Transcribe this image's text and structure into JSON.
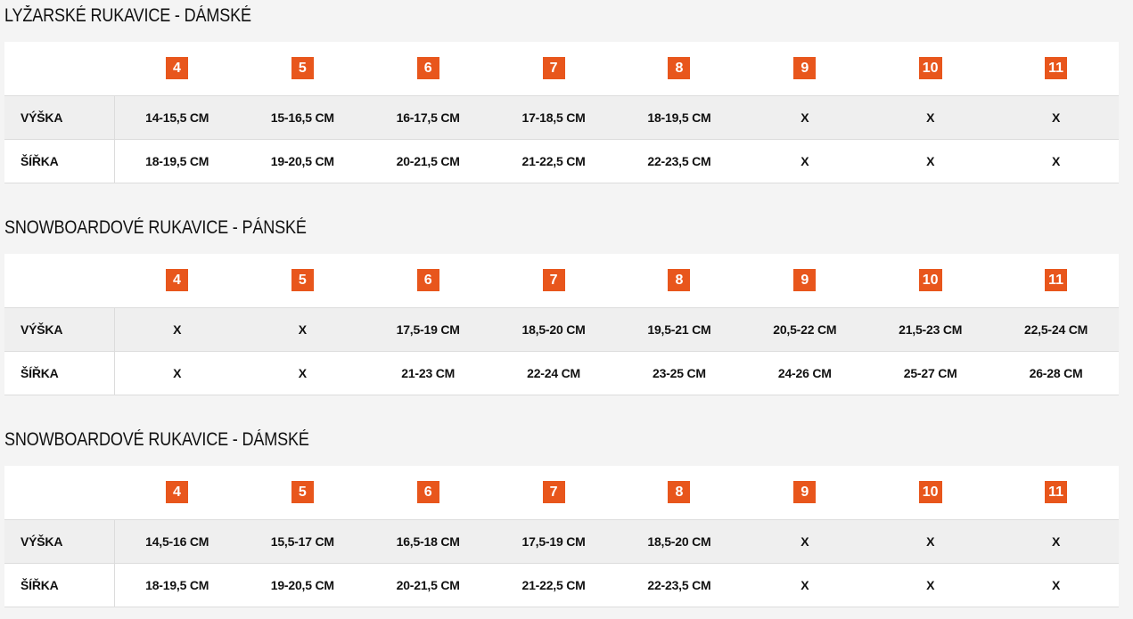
{
  "sizes": [
    "4",
    "5",
    "6",
    "7",
    "8",
    "9",
    "10",
    "11"
  ],
  "tables": [
    {
      "title": "LYŽARSKÉ RUKAVICE - DÁMSKÉ",
      "rows": [
        {
          "label": "VÝŠKA",
          "values": [
            "14-15,5 CM",
            "15-16,5 CM",
            "16-17,5 CM",
            "17-18,5 CM",
            "18-19,5 CM",
            "X",
            "X",
            "X"
          ]
        },
        {
          "label": "ŠÍŘKA",
          "values": [
            "18-19,5 CM",
            "19-20,5 CM",
            "20-21,5 CM",
            "21-22,5 CM",
            "22-23,5 CM",
            "X",
            "X",
            "X"
          ]
        }
      ]
    },
    {
      "title": "SNOWBOARDOVÉ RUKAVICE - PÁNSKÉ",
      "rows": [
        {
          "label": "VÝŠKA",
          "values": [
            "X",
            "X",
            "17,5-19 CM",
            "18,5-20 CM",
            "19,5-21 CM",
            "20,5-22 CM",
            "21,5-23 CM",
            "22,5-24 CM"
          ]
        },
        {
          "label": "ŠÍŘKA",
          "values": [
            "X",
            "X",
            "21-23 CM",
            "22-24 CM",
            "23-25 CM",
            "24-26 CM",
            "25-27 CM",
            "26-28 CM"
          ]
        }
      ]
    },
    {
      "title": "SNOWBOARDOVÉ RUKAVICE - DÁMSKÉ",
      "rows": [
        {
          "label": "VÝŠKA",
          "values": [
            "14,5-16 CM",
            "15,5-17 CM",
            "16,5-18 CM",
            "17,5-19 CM",
            "18,5-20 CM",
            "X",
            "X",
            "X"
          ]
        },
        {
          "label": "ŠÍŘKA",
          "values": [
            "18-19,5 CM",
            "19-20,5 CM",
            "20-21,5 CM",
            "21-22,5 CM",
            "22-23,5 CM",
            "X",
            "X",
            "X"
          ]
        }
      ]
    }
  ],
  "colors": {
    "badge": "#e8561c",
    "background": "#f4f4f4",
    "row_shaded": "#efefef",
    "text": "#111111"
  }
}
